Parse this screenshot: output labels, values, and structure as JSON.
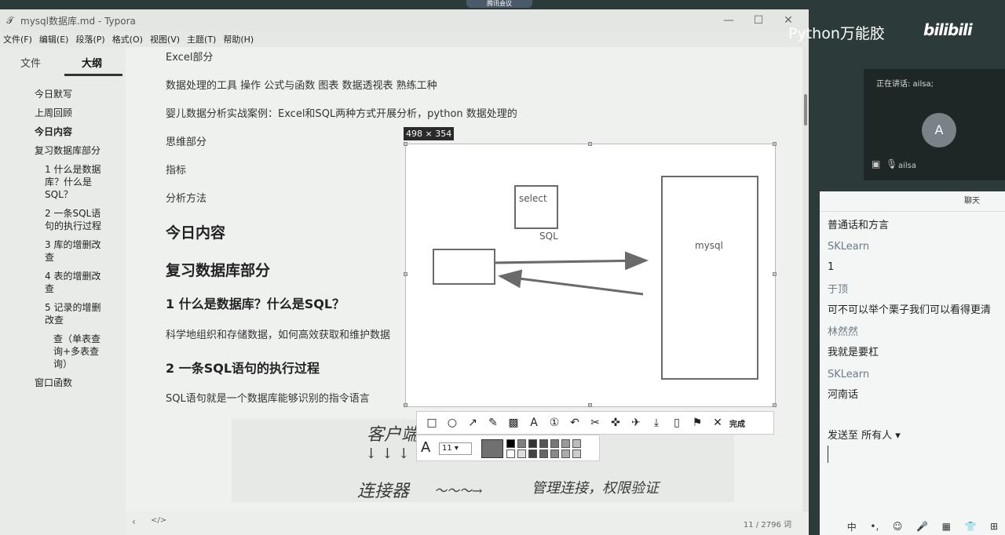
{
  "meeting_app": {
    "top_label": "腾讯会议"
  },
  "window": {
    "title": "mysql数据库.md - Typora",
    "app_icon": "typora-icon",
    "minimize": "—",
    "maximize": "☐",
    "close": "✕"
  },
  "menu": [
    "文件(F)",
    "编辑(E)",
    "段落(P)",
    "格式(O)",
    "视图(V)",
    "主题(T)",
    "帮助(H)"
  ],
  "sidebar": {
    "tab_files": "文件",
    "tab_outline": "大纲",
    "outline": [
      {
        "label": "今日默写",
        "level": 1
      },
      {
        "label": "上周回顾",
        "level": 1
      },
      {
        "label": "今日内容",
        "level": 1,
        "bold": true
      },
      {
        "label": "复习数据库部分",
        "level": 1
      },
      {
        "label": "1 什么是数据库？什么是SQL？",
        "level": 2
      },
      {
        "label": "2 一条SQL语句的执行过程",
        "level": 2
      },
      {
        "label": "3 库的增删改查",
        "level": 2
      },
      {
        "label": "4 表的增删改查",
        "level": 2
      },
      {
        "label": "5 记录的增删改查",
        "level": 2
      },
      {
        "label": "查（单表查询+多表查询）",
        "level": 3
      },
      {
        "label": "窗口函数",
        "level": 1
      }
    ]
  },
  "editor": {
    "p1": "Excel部分",
    "p2": "数据处理的工具 操作 公式与函数 图表  数据透视表 熟练工种",
    "p3": "婴儿数据分析实战案例：Excel和SQL两种方式开展分析，python 数据处理的",
    "p4": "思维部分",
    "p5": "指标",
    "p6": "分析方法",
    "h_today": "今日内容",
    "h_review": "复习数据库部分",
    "h_q1": "1 什么是数据库？什么是SQL？",
    "p_q1": "科学地组织和存储数据，如何高效获取和维护数据",
    "h_q2": "2 一条SQL语句的执行过程",
    "p_q2": "SQL语句就是一个数据库能够识别的指令语言",
    "hand_client": "客户端",
    "hand_connector": "连接器",
    "hand_arrow": "～～～→",
    "hand_note": "管理连接，权限验证"
  },
  "status": {
    "word_count": "11 / 2796 词",
    "back_icon": "‹",
    "source_icon": "</>"
  },
  "screenshot": {
    "size_label": "498 × 354",
    "select_label": "select",
    "sql_label": "SQL",
    "mysql_label": "mysql",
    "done_label": "完成",
    "font_size": "11",
    "tools": [
      "rectangle-tool",
      "ellipse-tool",
      "arrow-tool",
      "pen-tool",
      "mosaic-tool",
      "text-tool",
      "number-tool",
      "undo",
      "pin",
      "ocr",
      "translate",
      "save",
      "phone",
      "bookmark",
      "cancel"
    ],
    "tool_glyphs": [
      "□",
      "○",
      "↗",
      "✎",
      "▩",
      "A",
      "①",
      "↶",
      "✂",
      "✜",
      "✈",
      "⤓",
      "▯",
      "⚑",
      "✕"
    ],
    "colors": [
      "#000000",
      "#7f7f7f",
      "#333333",
      "#555555",
      "#777777",
      "#999999",
      "#bbbbbb",
      "#ffffff",
      "#dddddd",
      "#444444",
      "#666666",
      "#888888",
      "#aaaaaa",
      "#cccccc"
    ]
  },
  "brand": {
    "channel": "Python万能胶",
    "site": "bilibili"
  },
  "speaker": {
    "speaking": "正在讲话: ailsa;",
    "avatar_letter": "A",
    "name": "ailsa"
  },
  "chat": {
    "title": "聊天",
    "lines": [
      {
        "text": "普通话和方言",
        "type": "msg"
      },
      {
        "text": "SKLearn",
        "type": "name"
      },
      {
        "text": "1",
        "type": "msg"
      },
      {
        "text": "于顶",
        "type": "name"
      },
      {
        "text": "可不可以举个栗子我们可以看得更清",
        "type": "msg"
      },
      {
        "text": "林然然",
        "type": "name"
      },
      {
        "text": "我就是要杠",
        "type": "msg"
      },
      {
        "text": "SKLearn",
        "type": "name"
      },
      {
        "text": "河南话",
        "type": "msg"
      }
    ],
    "send_to": "发送至 所有人 ▾"
  },
  "tray": [
    "中",
    "•,",
    "☺",
    "🎤",
    "▦",
    "👕",
    "⊞"
  ]
}
